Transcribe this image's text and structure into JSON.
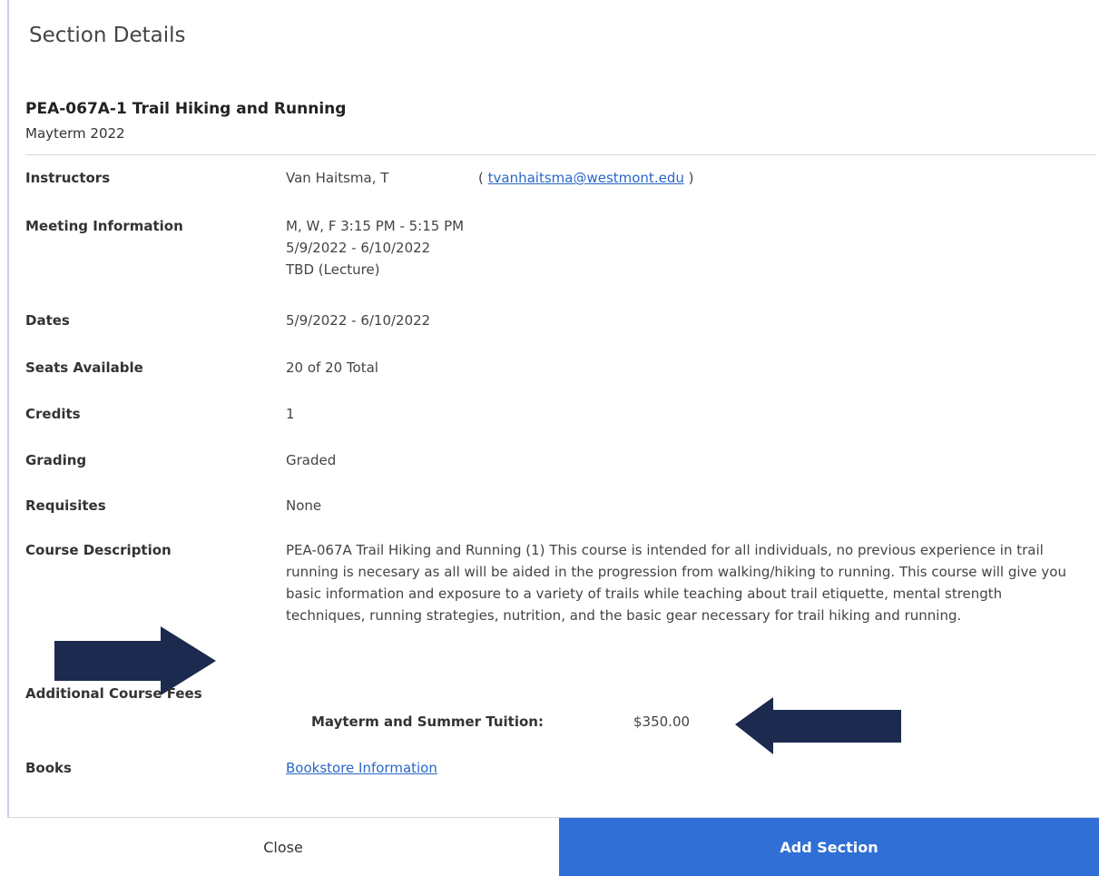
{
  "dialog": {
    "title": "Section Details"
  },
  "section": {
    "title": "PEA-067A-1 Trail Hiking and Running",
    "term": "Mayterm 2022"
  },
  "details": {
    "instructors_label": "Instructors",
    "instructor_name": "Van Haitsma, T",
    "instructor_email_open": "( ",
    "instructor_email": "tvanhaitsma@westmont.edu",
    "instructor_email_close": " )",
    "meeting_label": "Meeting Information",
    "meeting_lines": [
      "M, W, F 3:15 PM - 5:15 PM",
      "5/9/2022 - 6/10/2022",
      "TBD (Lecture)"
    ],
    "dates_label": "Dates",
    "dates_value": "5/9/2022 - 6/10/2022",
    "seats_label": "Seats Available",
    "seats_value": "20 of 20 Total",
    "credits_label": "Credits",
    "credits_value": "1",
    "grading_label": "Grading",
    "grading_value": "Graded",
    "requisites_label": "Requisites",
    "requisites_value": "None",
    "description_label": "Course Description",
    "description_value": "PEA-067A Trail Hiking and Running (1) This course is intended for all individuals, no previous experience in trail running is necesary as all will be aided in the progression from walking/hiking to running. This course will give you basic information and exposure to a variety of trails while teaching about trail etiquette, mental strength techniques, running strategies, nutrition, and the basic gear necessary for trail hiking and running.",
    "fees_label": "Additional Course Fees",
    "fee_name": "Mayterm and Summer Tuition:",
    "fee_amount": "$350.00",
    "books_label": "Books",
    "books_link": "Bookstore Information"
  },
  "footer": {
    "close_label": "Close",
    "add_label": "Add Section"
  },
  "colors": {
    "primary_button": "#2f6fd6",
    "link": "#2a67c9",
    "annotation_arrow": "#1c2a4f"
  },
  "icons": [
    "right-arrow-icon",
    "left-arrow-icon"
  ]
}
